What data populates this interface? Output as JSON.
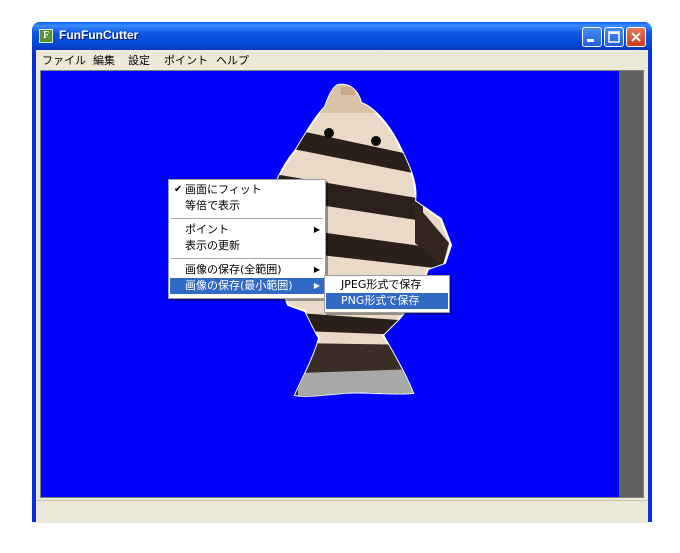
{
  "window": {
    "title": "FunFunCutter",
    "icon_letter": "F"
  },
  "menubar": [
    "ファイル",
    "編集",
    "設定",
    "ポイント",
    "ヘルプ"
  ],
  "context_menu": {
    "fit": "画面にフィット",
    "actual": "等倍で表示",
    "point": "ポイント",
    "refresh": "表示の更新",
    "save_full": "画像の保存(全範囲)",
    "save_min": "画像の保存(最小範囲)",
    "check": "✔",
    "arrow": "▶"
  },
  "submenu": {
    "jpeg": "JPEG形式で保存",
    "png": "PNG形式で保存"
  },
  "colors": {
    "canvas_bg": "#0000ff",
    "titlebar": "#0a5ff0",
    "highlight": "#316ac5"
  }
}
